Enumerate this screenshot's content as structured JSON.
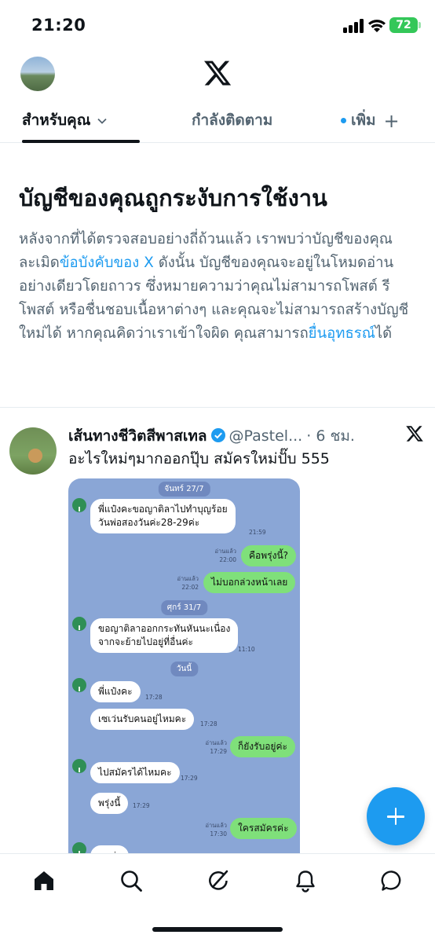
{
  "status_bar": {
    "time": "21:20",
    "battery": "72"
  },
  "header": {
    "logo": "x-logo"
  },
  "tabs": [
    {
      "label": "สำหรับคุณ",
      "active": true
    },
    {
      "label": "กำลังติดตาม",
      "active": false
    },
    {
      "label": "เพิ่ม",
      "active": false
    }
  ],
  "notice": {
    "title": "บัญชีของคุณถูกระงับการใช้งาน",
    "body_1": "หลังจากที่ได้ตรวจสอบอย่างถี่ถ้วนแล้ว เราพบว่าบัญชีของคุณละเมิด",
    "link_1": "ข้อบังคับของ X",
    "body_2": " ดังนั้น บัญชีของคุณจะอยู่ในโหมดอ่านอย่างเดียวโดยถาวร ซึ่งหมายความว่าคุณไม่สามารถโพสต์ รีโพสต์ หรือชื่นชอบเนื้อหาต่างๆ และคุณจะไม่สามารถสร้างบัญชีใหม่ได้ หากคุณคิดว่าเราเข้าใจผิด คุณสามารถ",
    "link_2": "ยื่นอุทธรณ์",
    "body_3": "ได้"
  },
  "tweet": {
    "name": "เส้นทางชีวิตสีพาสเทล",
    "handle": "@Pastel...",
    "time": "· 6 ชม.",
    "text": "อะไรใหม่ๆมากออกปุ๊บ สมัครใหม่ปั๊บ 555"
  },
  "chat": {
    "dates": [
      "จันทร์ 27/7",
      "ศุกร์ 31/7",
      "วันนี้"
    ],
    "messages": [
      {
        "dir": "in",
        "line1": "พี่แป๋งคะขอญาติลาไปทำบุญร้อย",
        "line2": "วันพ่อสองวันค่ะ28-29ค่ะ",
        "time": "21:59"
      },
      {
        "dir": "out",
        "line1": "คือพรุ่งนี้?",
        "read": "อ่านแล้ว",
        "time": "22:00"
      },
      {
        "dir": "out",
        "line1": "ไม่บอกล่วงหน้าเลย",
        "read": "อ่านแล้ว",
        "time": "22:02"
      },
      {
        "dir": "in",
        "line1": "ขอญาติลาออกกระทันหันนะเนื่อง",
        "line2": "จากจะย้ายไปอยู่ที่อื่นค่ะ",
        "time": "11:10"
      },
      {
        "dir": "in",
        "line1": "พี่แป๋งคะ",
        "time": "17:28"
      },
      {
        "dir": "in",
        "line1": "เซเว่นรับคนอยู่ไหมคะ",
        "time": "17:28"
      },
      {
        "dir": "out",
        "line1": "ก็ยังรับอยู่ค่ะ",
        "read": "อ่านแล้ว",
        "time": "17:29"
      },
      {
        "dir": "in",
        "line1": "ไปสมัครได้ไหมคะ",
        "time": "17:29"
      },
      {
        "dir": "in",
        "line1": "พรุ่งนี้",
        "time": "17:29"
      },
      {
        "dir": "out",
        "line1": "ใครสมัครค่ะ",
        "read": "อ่านแล้ว",
        "time": "17:30"
      },
      {
        "dir": "in",
        "line1": "ผมค่ะ"
      }
    ]
  },
  "compose": {
    "icon": "plus-icon"
  },
  "bottom_nav": [
    "home-icon",
    "search-icon",
    "grok-icon",
    "notifications-icon",
    "messages-icon"
  ],
  "colors": {
    "accent": "#1d9bf0",
    "text": "#0f1419",
    "muted": "#536471",
    "chat_bg": "#8aa6d6",
    "chat_out": "#7fe07a"
  }
}
